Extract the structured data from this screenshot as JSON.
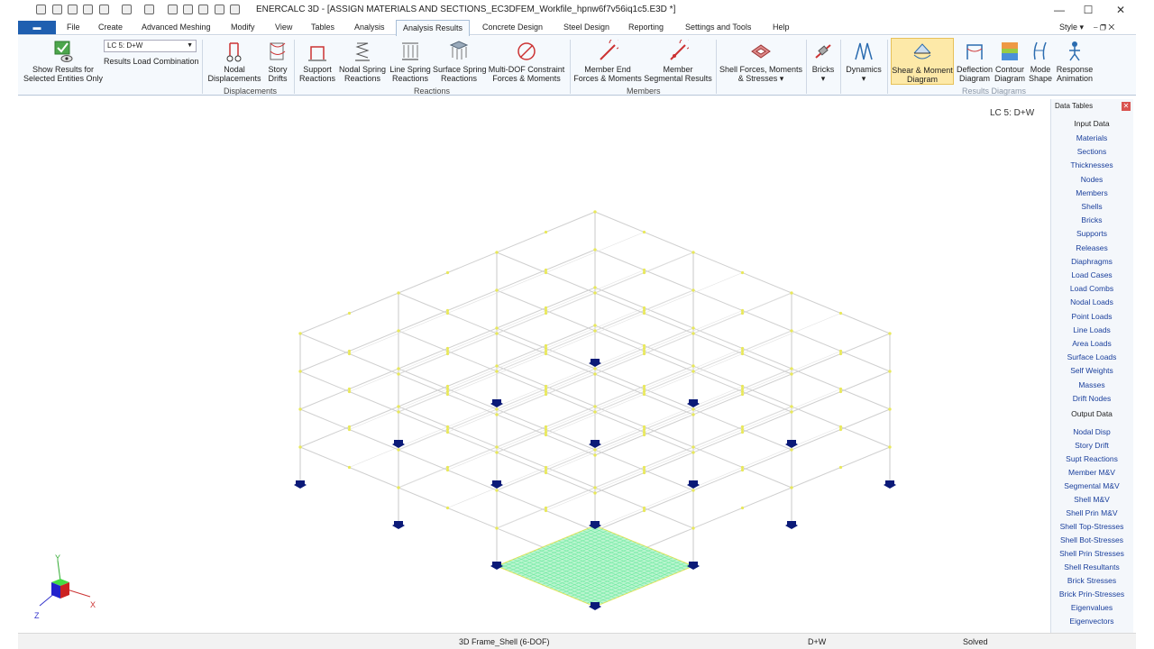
{
  "titlebar": {
    "title": "ENERCALC 3D - [ASSIGN MATERIALS AND SECTIONS_EC3DFEM_Workfile_hpnw6f7v56iq1c5.E3D *]",
    "minimize": "—",
    "maximize": "☐",
    "close": "✕"
  },
  "menubar": {
    "app_button": "▬",
    "items": [
      "File",
      "Create",
      "Advanced Meshing",
      "Modify",
      "View",
      "Tables",
      "Analysis",
      "Analysis Results",
      "Concrete Design",
      "Steel Design",
      "Reporting",
      "Settings and Tools",
      "Help"
    ],
    "active": "Analysis Results",
    "style": "Style ▾",
    "restore": "⎯  ❐  ✕"
  },
  "ribbon": {
    "show_selected": "Show Results for\nSelected Entities Only",
    "load_combo_value": "LC 5: D+W",
    "load_combo_caption": "Results Load Combination",
    "nodal_disp": "Nodal\nDisplacements",
    "story_drifts": "Story\nDrifts",
    "support_reactions": "Support\nReactions",
    "nodal_spring": "Nodal Spring\nReactions",
    "line_spring": "Line Spring\nReactions",
    "surface_spring": "Surface Spring\nReactions",
    "multi_dof": "Multi-DOF Constraint\nForces & Moments",
    "member_end": "Member End\nForces & Moments",
    "member_segmental": "Member\nSegmental Results",
    "shell_forces": "Shell Forces, Moments\n& Stresses ▾",
    "bricks": "Bricks\n▾",
    "dynamics": "Dynamics\n▾",
    "shear_moment": "Shear & Moment\nDiagram",
    "deflection": "Deflection\nDiagram",
    "contour": "Contour\nDiagram",
    "mode_shape": "Mode\nShape",
    "response_anim": "Response\nAnimation",
    "group_displacements": "Displacements",
    "group_reactions": "Reactions",
    "group_members": "Members",
    "group_results_diagrams": "Results Diagrams"
  },
  "canvas": {
    "load_case_label": "LC 5: D+W",
    "axis_x": "X",
    "axis_y": "Y",
    "axis_z": "Z"
  },
  "data_tables": {
    "title": "Data Tables",
    "close": "✕",
    "input_header": "Input Data",
    "input_items": [
      "Materials",
      "Sections",
      "Thicknesses",
      "Nodes",
      "Members",
      "Shells",
      "Bricks",
      "Supports",
      "Releases",
      "Diaphragms",
      "Load Cases",
      "Load Combs",
      "Nodal Loads",
      "Point Loads",
      "Line Loads",
      "Area Loads",
      "Surface Loads",
      "Self Weights",
      "Masses",
      "Drift Nodes"
    ],
    "output_header": "Output Data",
    "output_items": [
      "Nodal Disp",
      "Story Drift",
      "Supt Reactions",
      "Member M&V",
      "Segmental M&V",
      "Shell M&V",
      "Shell Prin M&V",
      "Shell Top-Stresses",
      "Shell Bot-Stresses",
      "Shell Prin Stresses",
      "Shell Resultants",
      "Brick Stresses",
      "Brick Prin-Stresses",
      "Eigenvalues",
      "Eigenvectors"
    ]
  },
  "statusbar": {
    "model_type": "3D Frame_Shell (6-DOF)",
    "load_case": "D+W",
    "state": "Solved"
  },
  "colors": {
    "accent": "#1f5fb0",
    "highlight": "#fde9a8",
    "support": "#0b1a78",
    "mesh": "#6ee9a0",
    "node": "#e8e85a"
  }
}
